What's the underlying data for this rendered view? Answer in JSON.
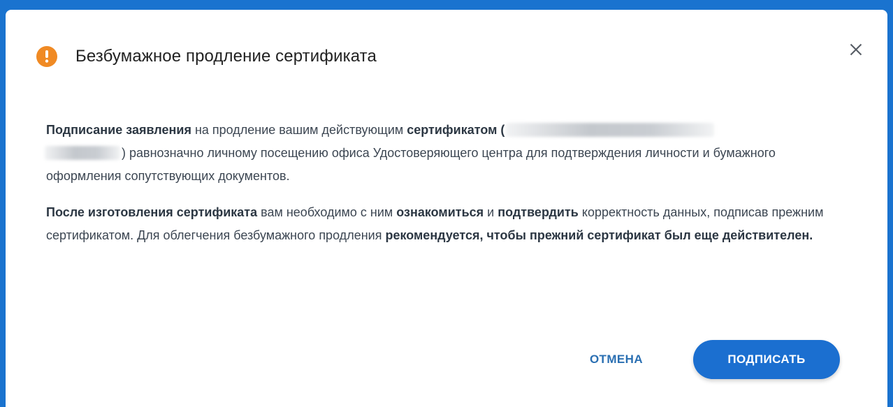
{
  "dialog": {
    "title": "Безбумажное продление сертификата",
    "icon": "warning-icon",
    "close_icon": "close-icon",
    "accent_color": "#f08a24"
  },
  "content": {
    "p1": {
      "b1": "Подписание заявления",
      "t1": " на продление вашим действующим ",
      "b2": "сертификатом (",
      "t2": ") равнозначно личному посещению офиса Удостоверяющего центра для подтверждения личности и бумажного оформления сопутствующих документов."
    },
    "p2": {
      "b1": "После изготовления сертификата",
      "t1": " вам необходимо с ним ",
      "b2": "ознакомиться",
      "t2": " и ",
      "b3": "подтвердить",
      "t3": " корректность данных, подписав прежним сертификатом. Для облегчения безбумажного продления ",
      "b4": "рекомендуется, чтобы прежний сертификат был еще действителен."
    }
  },
  "actions": {
    "cancel_label": "ОТМЕНА",
    "sign_label": "ПОДПИСАТЬ",
    "primary_color": "#1b6fd0"
  }
}
